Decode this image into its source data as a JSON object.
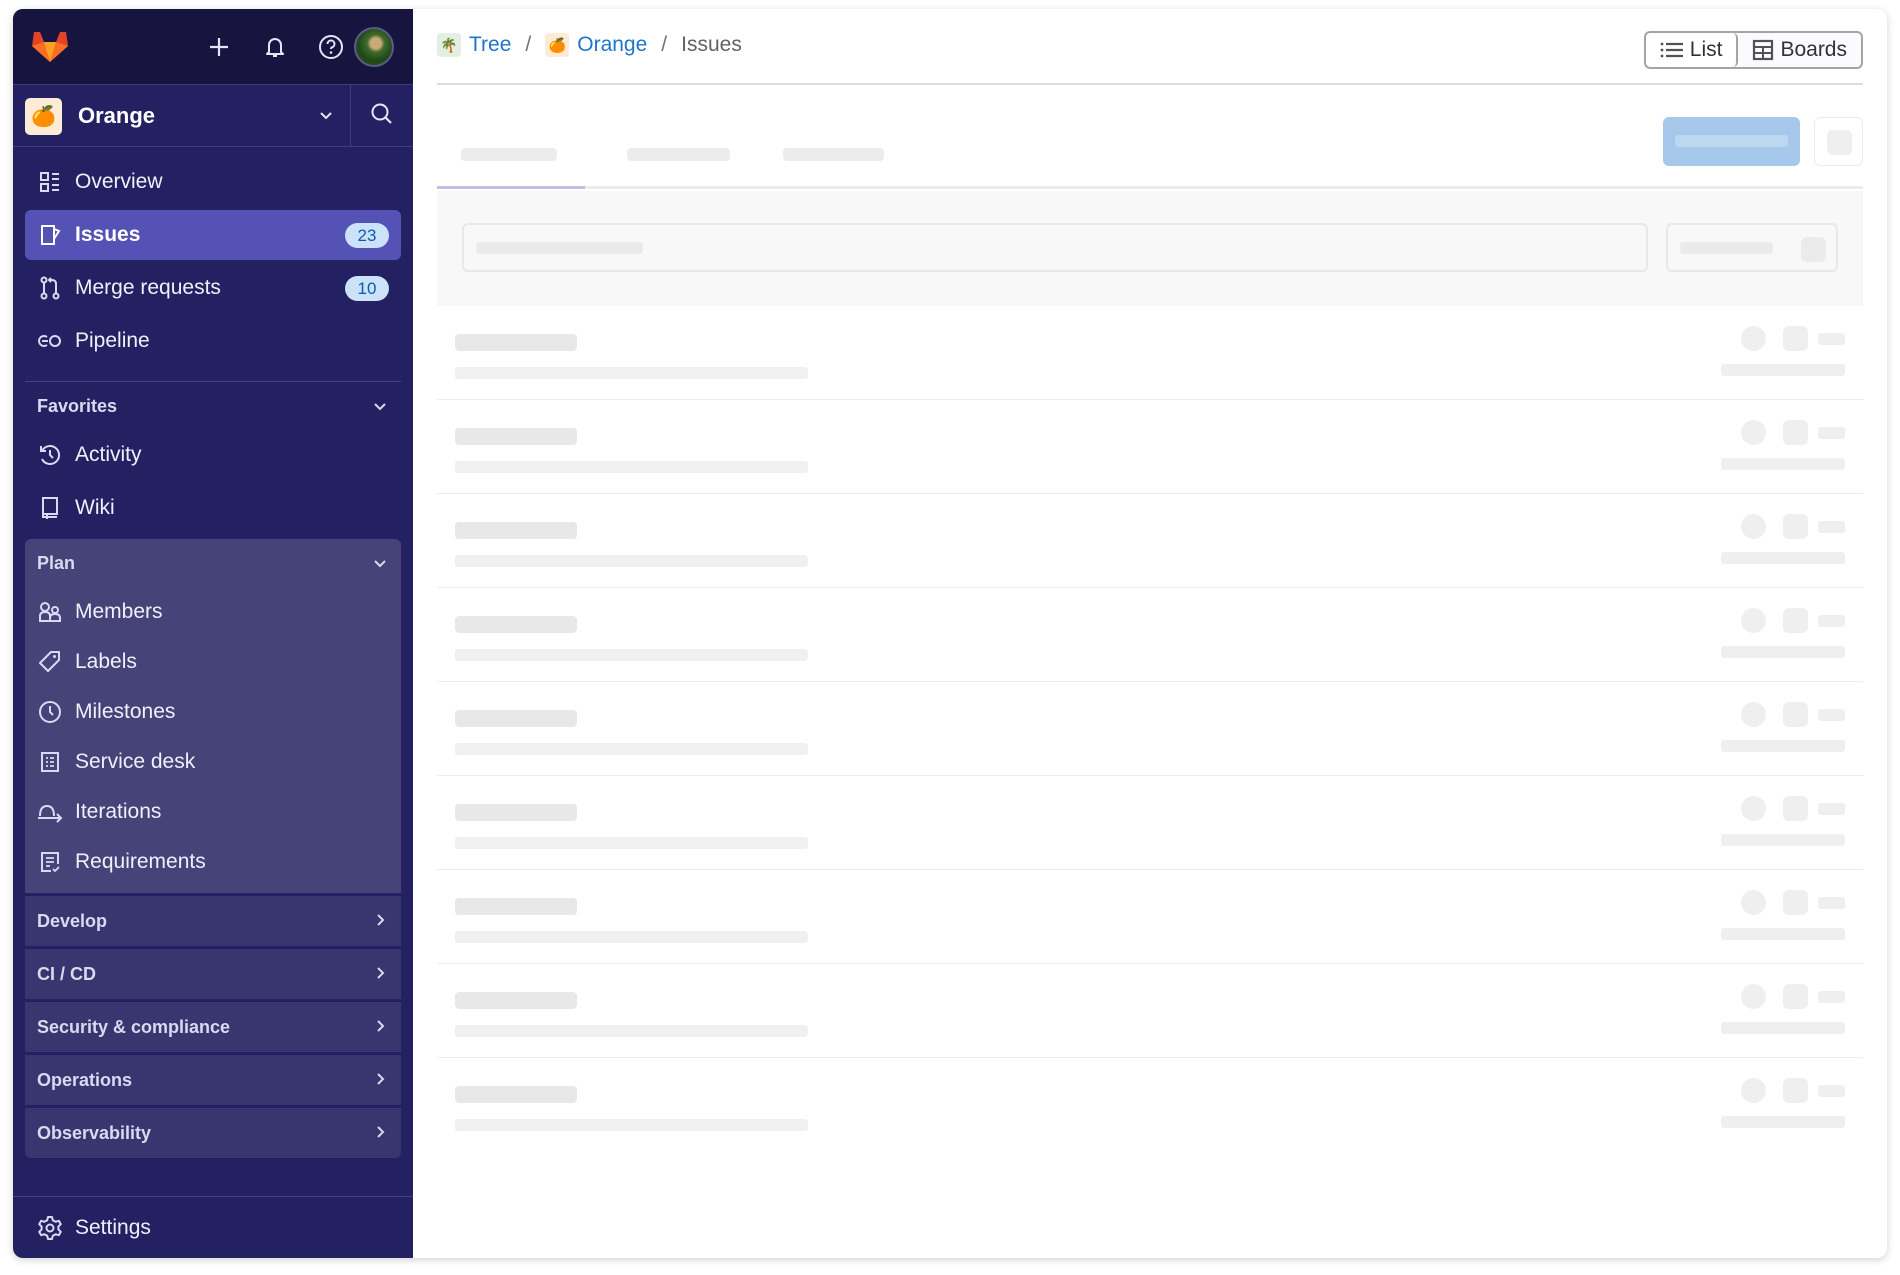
{
  "topbar": {
    "logo_icon": "gitlab-tanuki-icon",
    "create_icon": "plus-icon",
    "notifications_icon": "bell-icon",
    "help_icon": "question-circle-icon",
    "avatar_icon": "user-avatar"
  },
  "project_selector": {
    "avatar_emoji": "🍊",
    "name": "Orange",
    "chevron_icon": "chevron-down-icon",
    "search_icon": "search-icon"
  },
  "sidebar": {
    "primary": [
      {
        "label": "Overview",
        "icon": "overview-icon",
        "active": false
      },
      {
        "label": "Issues",
        "icon": "issues-icon",
        "active": true,
        "badge": "23"
      },
      {
        "label": "Merge requests",
        "icon": "merge-request-icon",
        "active": false,
        "badge": "10"
      },
      {
        "label": "Pipeline",
        "icon": "pipeline-icon",
        "active": false
      }
    ],
    "favorites": {
      "label": "Favorites",
      "items": [
        {
          "label": "Activity",
          "icon": "history-icon"
        },
        {
          "label": "Wiki",
          "icon": "book-icon"
        }
      ]
    },
    "plan": {
      "label": "Plan",
      "items": [
        {
          "label": "Members",
          "icon": "users-icon"
        },
        {
          "label": "Labels",
          "icon": "label-icon"
        },
        {
          "label": "Milestones",
          "icon": "clock-icon"
        },
        {
          "label": "Service desk",
          "icon": "service-desk-icon"
        },
        {
          "label": "Iterations",
          "icon": "iteration-icon"
        },
        {
          "label": "Requirements",
          "icon": "requirements-icon"
        }
      ]
    },
    "collapsed_sections": [
      {
        "label": "Develop"
      },
      {
        "label": "CI / CD"
      },
      {
        "label": "Security & compliance"
      },
      {
        "label": "Operations"
      },
      {
        "label": "Observability"
      }
    ],
    "settings": {
      "label": "Settings",
      "icon": "settings-icon"
    }
  },
  "breadcrumb": {
    "items": [
      {
        "label": "Tree",
        "emoji": "🌴",
        "link": true
      },
      {
        "label": "Orange",
        "emoji": "🍊",
        "link": true
      },
      {
        "label": "Issues",
        "link": false
      }
    ],
    "separator": "/"
  },
  "view_toggle": {
    "list_label": "List",
    "boards_label": "Boards",
    "active": "List"
  },
  "content": {
    "state": "loading",
    "skeleton_rows": 9
  },
  "colors": {
    "sidebar_bg": "#232161",
    "topbar_bg": "#171540",
    "active_item": "#5452b4",
    "link": "#1f75cb",
    "badge_bg": "#cbe2f9",
    "badge_text": "#0b5cad"
  }
}
